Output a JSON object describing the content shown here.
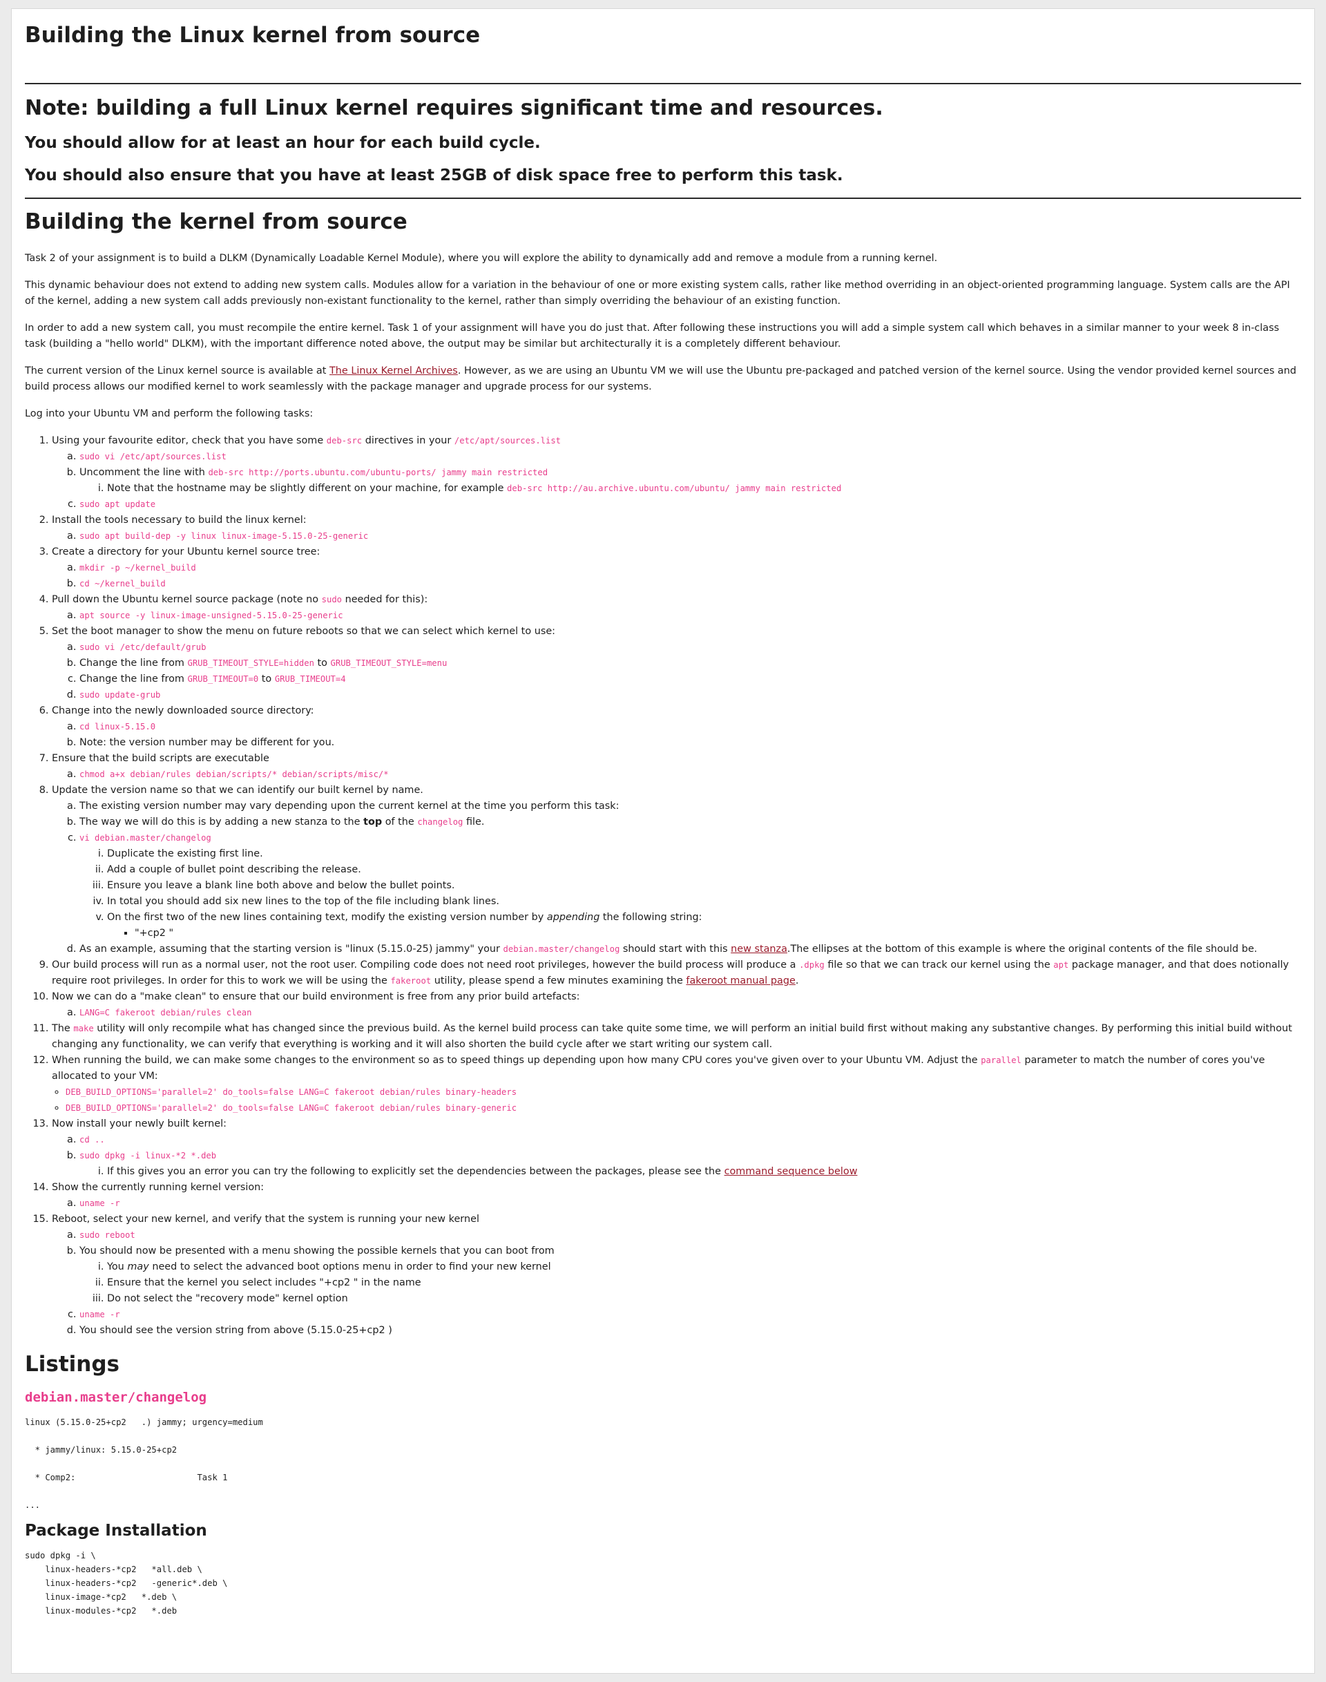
{
  "title": "Building the Linux kernel from source",
  "note": {
    "heading": "Note: building a full Linux kernel requires significant time and resources.",
    "line1": "You should allow for at least an hour for each build cycle.",
    "line2": "You should also ensure that you have at least 25GB of disk space free to perform this task."
  },
  "section": "Building the kernel from source",
  "paras": {
    "p1": "Task 2 of your assignment is to build a DLKM (Dynamically Loadable Kernel Module), where you will explore the ability to dynamically add and remove a module from a running kernel.",
    "p2": "This dynamic behaviour does not extend to adding new system calls. Modules allow for a variation in the behaviour of one or more existing system calls, rather like method overriding in an object-oriented programming language. System calls are the API of the kernel, adding a new system call adds previously non-existant functionality to the kernel, rather than simply overriding the behaviour of an existing function.",
    "p3": "In order to add a new system call, you must recompile the entire kernel. Task 1 of your assignment will have you do just that. After following these instructions you will add a simple system call which behaves in a similar manner to your week 8 in-class task (building a \"hello world\" DLKM), with the important difference noted above, the output may be similar but architecturally it is a completely different behaviour.",
    "p4a": "The current version of the Linux kernel source is available at ",
    "p4link": "The Linux Kernel Archives",
    "p4b": ". However, as we are using an Ubuntu VM we will use the Ubuntu pre-packaged and patched version of the kernel source. Using the vendor provided kernel sources and build process allows our modified kernel to work seamlessly with the package manager and upgrade process for our systems.",
    "p5": "Log into your Ubuntu VM and perform the following tasks:"
  },
  "steps": {
    "s1": {
      "t1": "Using your favourite editor, check that you have some ",
      "c1": "deb-src",
      "t2": " directives in your ",
      "c2": "/etc/apt/sources.list",
      "a": "sudo vi /etc/apt/sources.list",
      "b_t": "Uncomment the line with ",
      "b_c": "deb-src http://ports.ubuntu.com/ubuntu-ports/ jammy main restricted",
      "b_i_t": "Note that the hostname may be slightly different on your machine, for example ",
      "b_i_c": "deb-src http://au.archive.ubuntu.com/ubuntu/ jammy main restricted",
      "c": "sudo apt update"
    },
    "s2": {
      "t": "Install the tools necessary to build the linux kernel:",
      "a": "sudo apt build-dep -y linux linux-image-5.15.0-25-generic"
    },
    "s3": {
      "t": "Create a directory for your Ubuntu kernel source tree:",
      "a": "mkdir -p ~/kernel_build",
      "b": "cd ~/kernel_build"
    },
    "s4": {
      "t1": "Pull down the Ubuntu kernel source package (note no ",
      "c": "sudo",
      "t2": " needed for this):",
      "a": "apt source -y linux-image-unsigned-5.15.0-25-generic"
    },
    "s5": {
      "t": "Set the boot manager to show the menu on future reboots so that we can select which kernel to use:",
      "a": "sudo vi /etc/default/grub",
      "b_t1": "Change the line from ",
      "b_c1": "GRUB_TIMEOUT_STYLE=hidden",
      "b_t2": " to ",
      "b_c2": "GRUB_TIMEOUT_STYLE=menu",
      "c_t1": "Change the line from ",
      "c_c1": "GRUB_TIMEOUT=0",
      "c_t2": " to ",
      "c_c2": "GRUB_TIMEOUT=4",
      "d": "sudo update-grub"
    },
    "s6": {
      "t": "Change into the newly downloaded source directory:",
      "a": "cd linux-5.15.0",
      "b": "Note: the version number may be different for you."
    },
    "s7": {
      "t": "Ensure that the build scripts are executable",
      "a": "chmod a+x debian/rules debian/scripts/* debian/scripts/misc/*"
    },
    "s8": {
      "t": "Update the version name so that we can identify our built kernel by name.",
      "a": "The existing version number may vary depending upon the current kernel at the time you perform this task:",
      "b_t1": "The way we will do this is by adding a new stanza to the ",
      "b_strong": "top",
      "b_t2": " of the ",
      "b_c": "changelog",
      "b_t3": " file.",
      "c": "vi debian.master/changelog",
      "c_i": "Duplicate the existing first line.",
      "c_ii": "Add a couple of bullet point describing the release.",
      "c_iii": "Ensure you leave a blank line both above and below the bullet points.",
      "c_iv": "In total you should add six new lines to the top of the file including blank lines.",
      "c_v_t1": "On the first two of the new lines containing text, modify the existing version number by ",
      "c_v_em": "appending",
      "c_v_t2": " the following string:",
      "c_v_bullet": "\"+cp2      \"",
      "d_t1": "As an example, assuming that the starting version is \"linux (5.15.0-25) jammy\" your ",
      "d_c": "debian.master/changelog",
      "d_t2": " should start with this ",
      "d_link": "new stanza",
      "d_t3": ".The ellipses at the bottom of this example is where the original contents of the file should be."
    },
    "s9": {
      "t1": "Our build process will run as a normal user, not the root user. Compiling code does not need root privileges, however the build process will produce a ",
      "c1": ".dpkg",
      "t2": " file so that we can track our kernel using the ",
      "c2": "apt",
      "t3": " package manager, and that does notionally require root privileges. In order for this to work we will be using the ",
      "c3": "fakeroot",
      "t4": " utility, please spend a few minutes examining the ",
      "link": "fakeroot manual page",
      "t5": "."
    },
    "s10": {
      "t": "Now we can do a \"make clean\" to ensure that our build environment is free from any prior build artefacts:",
      "a": "LANG=C fakeroot debian/rules clean"
    },
    "s11": {
      "t1": "The ",
      "c": "make",
      "t2": " utility will only recompile what has changed since the previous build. As the kernel build process can take quite some time, we will perform an initial build first without making any substantive changes. By performing this initial build without changing any functionality, we can verify that everything is working and it will also shorten the build cycle after we start writing our system call."
    },
    "s12": {
      "t1": "When running the build, we can make some changes to the environment so as to speed things up depending upon how many CPU cores you've given over to your Ubuntu VM. Adjust the ",
      "c": "parallel",
      "t2": " parameter to match the number of cores you've allocated to your VM:",
      "b1": "DEB_BUILD_OPTIONS='parallel=2' do_tools=false LANG=C fakeroot debian/rules binary-headers",
      "b2": "DEB_BUILD_OPTIONS='parallel=2' do_tools=false LANG=C fakeroot debian/rules binary-generic"
    },
    "s13": {
      "t": "Now install your newly built kernel:",
      "a": "cd ..",
      "b": "sudo dpkg -i linux-*2   *.deb",
      "b_i_t": "If this gives you an error you can try the following to explicitly set the dependencies between the packages, please see the ",
      "b_i_link": "command sequence below"
    },
    "s14": {
      "t": "Show the currently running kernel version:",
      "a": "uname -r"
    },
    "s15": {
      "t": "Reboot, select your new kernel, and verify that the system is running your new kernel",
      "a": "sudo reboot",
      "b": "You should now be presented with a menu showing the possible kernels that you can boot from",
      "b_i_t1": "You ",
      "b_i_em": "may",
      "b_i_t2": " need to select the advanced boot options menu in order to find your new kernel",
      "b_ii": "Ensure that the kernel you select includes \"+cp2      \" in the name",
      "b_iii": "Do not select the \"recovery mode\" kernel option",
      "c": "uname -r",
      "d": "You should see the version string from above (5.15.0-25+cp2      )"
    }
  },
  "listings": {
    "heading": "Listings",
    "changelog_title": "debian.master/changelog",
    "changelog_code": "linux (5.15.0-25+cp2   .) jammy; urgency=medium\n\n  * jammy/linux: 5.15.0-25+cp2\n\n  * Comp2:                        Task 1\n\n...",
    "pkg_title": "Package Installation",
    "pkg_code": "sudo dpkg -i \\\n    linux-headers-*cp2   *all.deb \\\n    linux-headers-*cp2   -generic*.deb \\\n    linux-image-*cp2   *.deb \\\n    linux-modules-*cp2   *.deb"
  }
}
